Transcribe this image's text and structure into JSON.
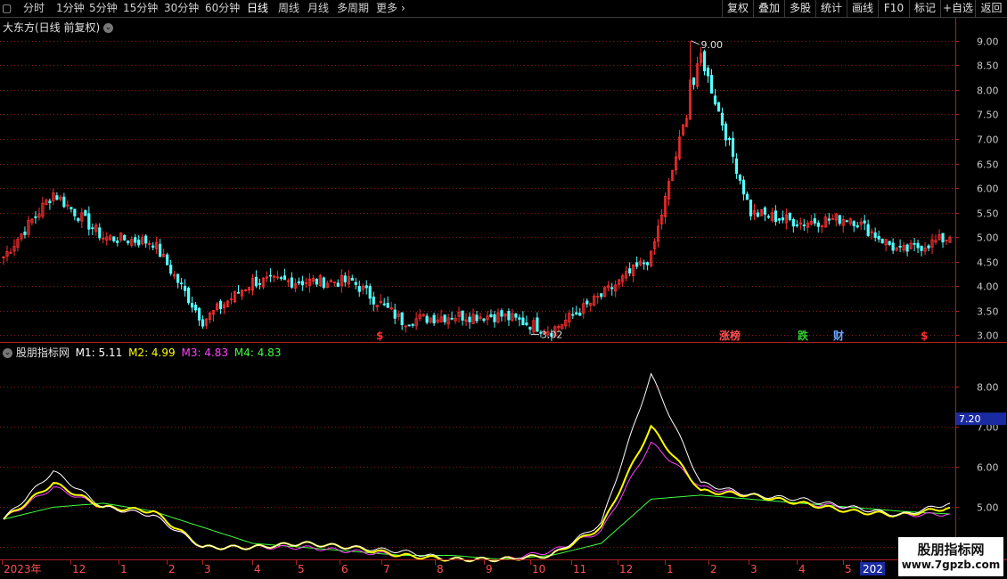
{
  "toolbar": {
    "periods": [
      "分时",
      "1分钟",
      "5分钟",
      "15分钟",
      "30分钟",
      "60分钟",
      "日线",
      "周线",
      "月线",
      "多周期",
      "更多"
    ],
    "active_period": "日线",
    "right_buttons": [
      "复权",
      "叠加",
      "多股",
      "统计",
      "画线",
      "F10",
      "标记",
      "+自选",
      "返回"
    ]
  },
  "main_panel": {
    "title": "大东方(日线 前复权)",
    "high_label": "9.00",
    "low_label": "3.02",
    "y_ticks": [
      "9.00",
      "8.50",
      "8.00",
      "7.50",
      "7.00",
      "6.50",
      "6.00",
      "5.50",
      "5.00",
      "4.50",
      "4.00",
      "3.50",
      "3.00"
    ],
    "markers": [
      {
        "label": "$",
        "color": "#ff3030",
        "x": "2023-07-04"
      },
      {
        "label": "涨榜",
        "color": "#ff5050",
        "x": "2024-02-21"
      },
      {
        "label": "跌",
        "color": "#30d030",
        "x": "2024-03-27"
      },
      {
        "label": "财",
        "color": "#6aa8ff",
        "x": "2024-04-18"
      },
      {
        "label": "$",
        "color": "#ff3030",
        "x": "2024-05-27"
      }
    ]
  },
  "indicator_panel": {
    "name": "股朋指标网",
    "items": [
      {
        "label": "M1: 5.11",
        "color": "#ffffff"
      },
      {
        "label": "M2: 4.99",
        "color": "#ffff00"
      },
      {
        "label": "M3: 4.83",
        "color": "#ff40ff"
      },
      {
        "label": "M4: 4.83",
        "color": "#40ff40"
      }
    ],
    "y_ticks": [
      "8.00",
      "7.00",
      "6.00",
      "5.00",
      "4.00"
    ],
    "current_value": "7.20"
  },
  "x_axis": {
    "labels": [
      "2023年",
      "12",
      "1",
      "2",
      "3",
      "4",
      "5",
      "6",
      "7",
      "8",
      "9",
      "10",
      "11",
      "12",
      "1",
      "2",
      "3",
      "4",
      "5",
      "202"
    ]
  },
  "watermark": {
    "line1": "股朋指标网",
    "line2": "www.7gpzb.com"
  },
  "colors": {
    "up": "#ff3030",
    "down": "#54ffff",
    "grid": "#8a1818",
    "axis": "#b02020"
  },
  "chart_data": {
    "type": "candlestick",
    "title": "大东方(日线 前复权)",
    "x": [
      "2023-11",
      "2023-12",
      "2024-01",
      "2024-02",
      "2024-03",
      "2024-04",
      "2024-05",
      "2024-06",
      "2024-07",
      "2024-08",
      "2024-09",
      "2024-10",
      "2024-11",
      "2024-12",
      "2025-01",
      "2025-02",
      "2025-03",
      "2025-04",
      "2025-05",
      "2025-06"
    ],
    "close_approx": [
      4.6,
      5.9,
      5.0,
      4.9,
      3.3,
      4.1,
      4.1,
      4.1,
      3.3,
      3.4,
      3.4,
      3.1,
      3.8,
      4.6,
      8.7,
      5.5,
      5.3,
      5.4,
      4.7,
      5.0
    ],
    "high": 9.0,
    "low": 3.02,
    "ylim": [
      2.9,
      9.25
    ],
    "indicator": {
      "name": "股朋指标网",
      "ylim": [
        3.7,
        8.8
      ],
      "series": [
        {
          "name": "M1",
          "color": "#ffffff",
          "values": [
            4.7,
            5.9,
            5.0,
            4.8,
            4.0,
            4.0,
            4.1,
            4.0,
            3.9,
            3.7,
            3.7,
            3.8,
            4.6,
            8.3,
            5.6,
            5.3,
            5.2,
            5.0,
            4.8,
            5.1
          ]
        },
        {
          "name": "M2",
          "color": "#ffff00",
          "values": [
            4.7,
            5.6,
            5.0,
            4.9,
            4.0,
            4.0,
            4.1,
            4.0,
            3.8,
            3.7,
            3.7,
            3.8,
            4.5,
            7.0,
            5.4,
            5.3,
            5.1,
            4.9,
            4.8,
            4.99
          ]
        },
        {
          "name": "M3",
          "color": "#ff40ff",
          "values": [
            4.7,
            5.5,
            5.0,
            4.8,
            4.0,
            4.0,
            4.0,
            3.9,
            3.8,
            3.7,
            3.7,
            3.9,
            4.4,
            6.6,
            5.5,
            5.3,
            5.1,
            5.0,
            4.8,
            4.83
          ]
        },
        {
          "name": "M4",
          "color": "#40ff40",
          "values": [
            4.7,
            5.0,
            5.1,
            4.9,
            4.5,
            4.1,
            4.0,
            3.9,
            3.8,
            3.8,
            3.7,
            3.8,
            4.1,
            5.2,
            5.3,
            5.2,
            5.1,
            5.0,
            4.9,
            4.83
          ]
        }
      ]
    }
  }
}
